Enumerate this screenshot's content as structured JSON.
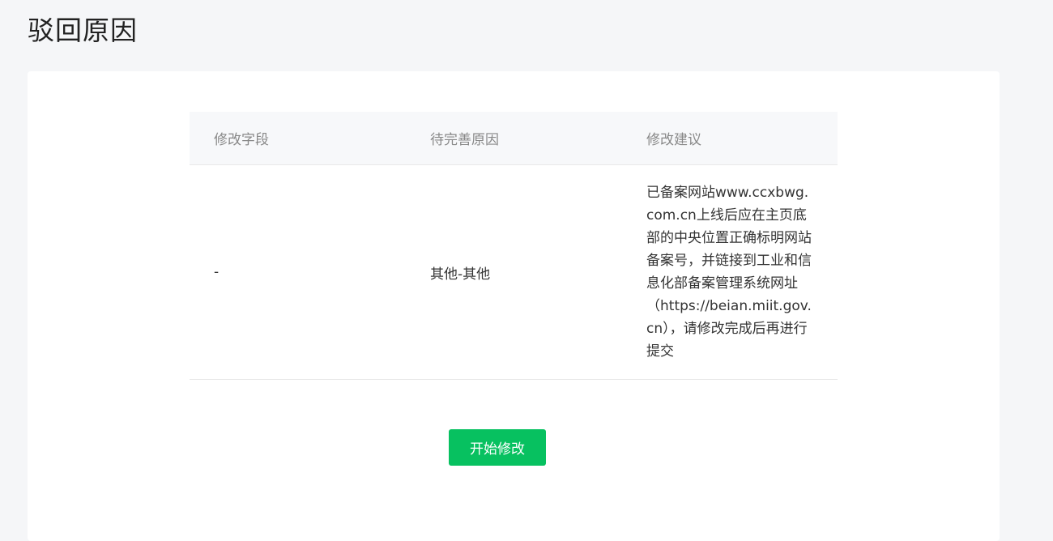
{
  "page": {
    "title": "驳回原因"
  },
  "table": {
    "headers": [
      "修改字段",
      "待完善原因",
      "修改建议"
    ],
    "rows": [
      {
        "field": "-",
        "reason": "其他-其他",
        "suggestion": "已备案网站www.ccxbwg.com.cn上线后应在主页底部的中央位置正确标明网站备案号，并链接到工业和信息化部备案管理系统网址（https://beian.miit.gov.cn），请修改完成后再进行提交"
      }
    ]
  },
  "actions": {
    "start_edit_label": "开始修改",
    "accent_color": "#07c160"
  }
}
